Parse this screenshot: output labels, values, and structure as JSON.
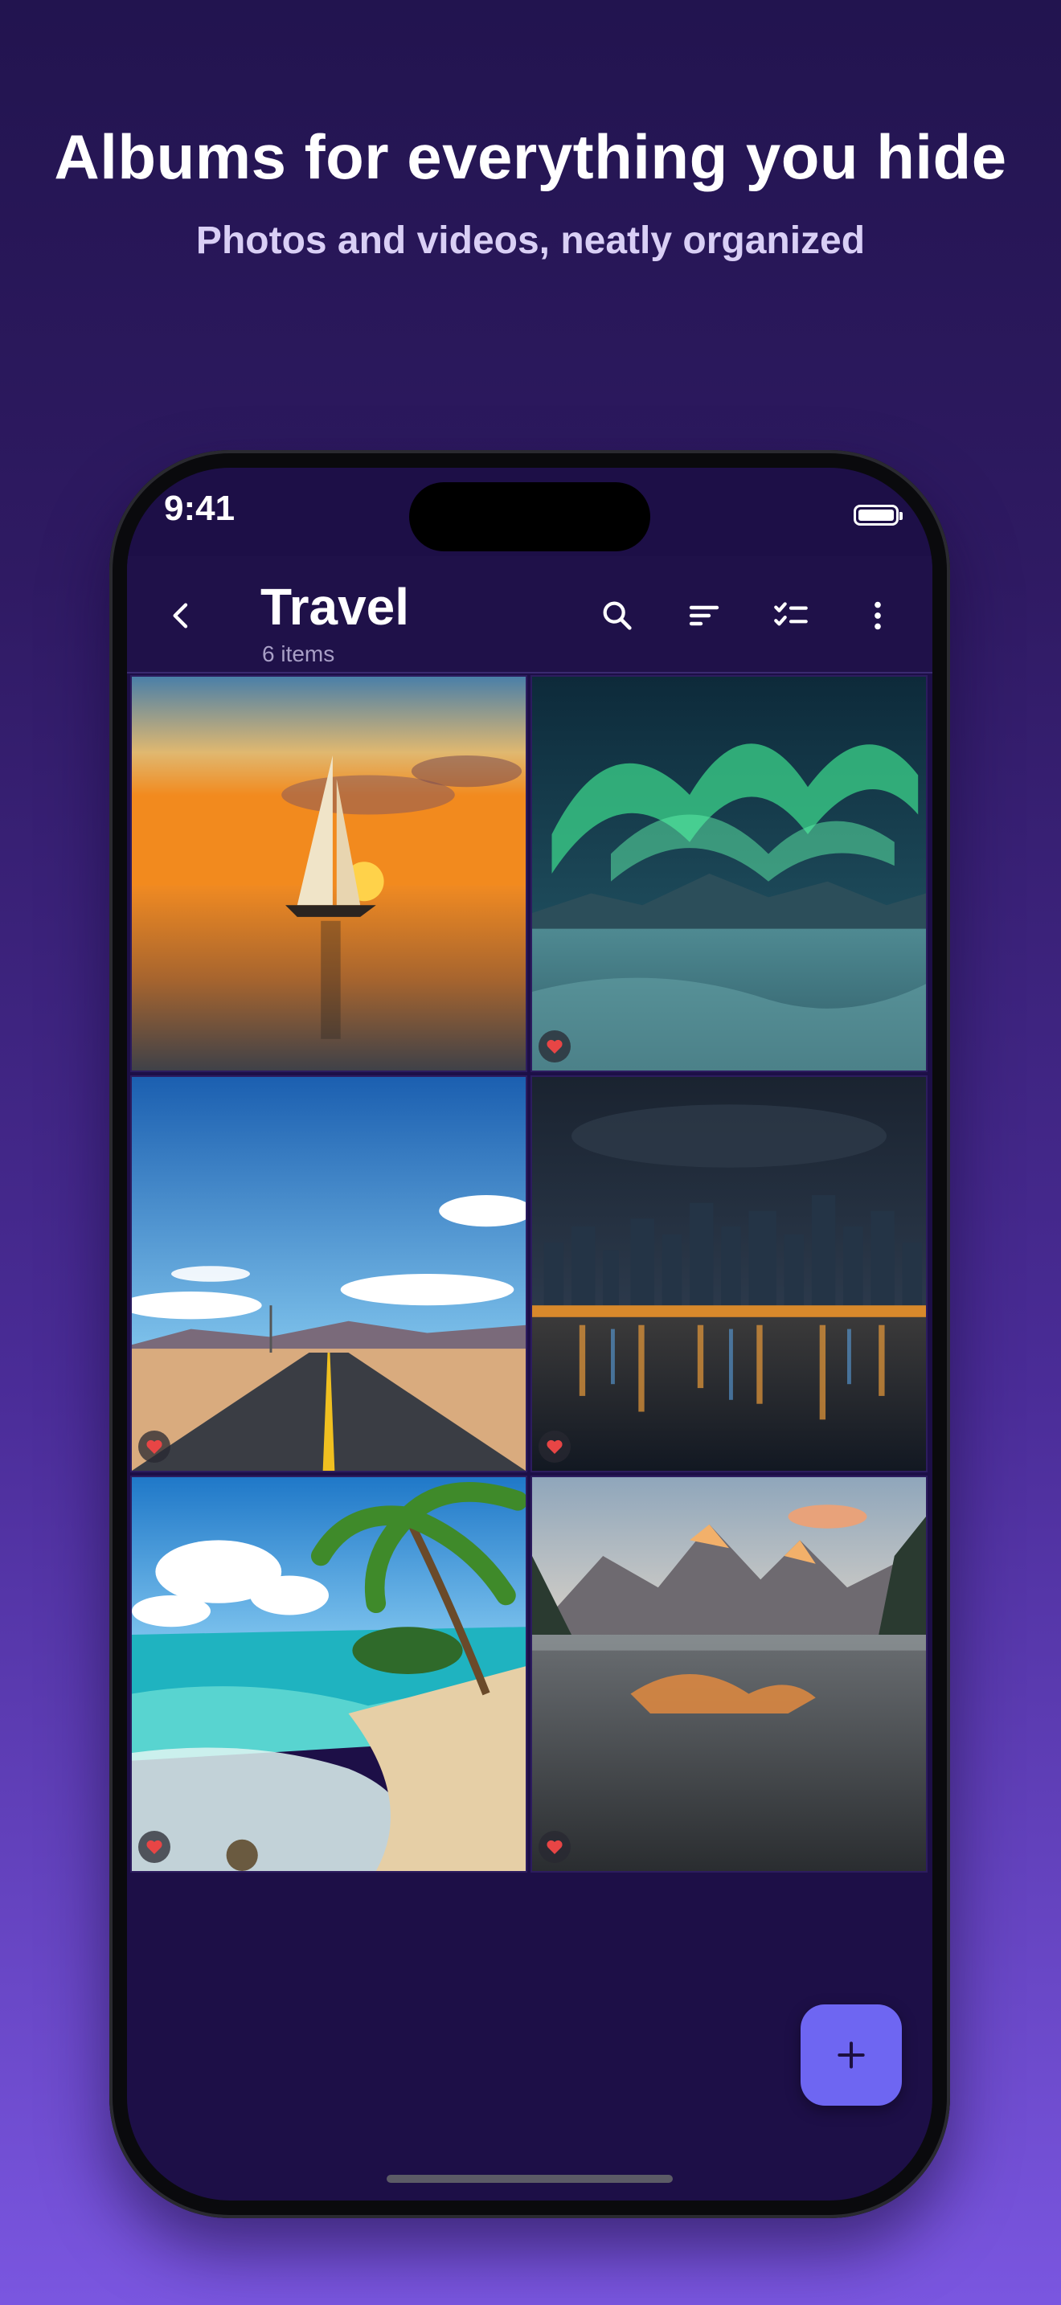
{
  "promo": {
    "headline": "Albums for everything you hide",
    "subheadline": "Photos and videos, neatly organized"
  },
  "status_bar": {
    "time": "9:41"
  },
  "album": {
    "title": "Travel",
    "count_label": "6 items"
  },
  "toolbar_icons": [
    "back-icon",
    "search-icon",
    "sort-icon",
    "select-icon",
    "more-vert-icon"
  ],
  "photos": [
    {
      "subject": "sailboat-sunset",
      "favorite": false
    },
    {
      "subject": "aurora-snow",
      "favorite": true
    },
    {
      "subject": "desert-road",
      "favorite": true
    },
    {
      "subject": "city-night-skyline",
      "favorite": true
    },
    {
      "subject": "tropical-beach",
      "favorite": true
    },
    {
      "subject": "mountain-lake",
      "favorite": true
    }
  ],
  "fab_label": "+",
  "colors": {
    "accent": "#6E66F2",
    "favorite_heart": "#E84545",
    "screen_bg": "#1D0F47"
  }
}
